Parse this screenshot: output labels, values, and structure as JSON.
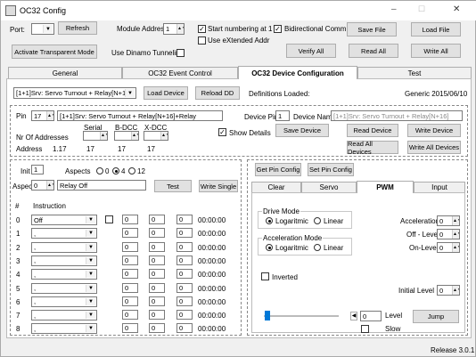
{
  "window": {
    "title": "OC32 Config",
    "min": "–",
    "max": "☐",
    "close": "✕",
    "status": "Release 3.0.1"
  },
  "top": {
    "port_label": "Port:",
    "port_value": "",
    "refresh": "Refresh",
    "module_address_label": "Module Address",
    "module_address": "1",
    "start_numbering": "Start numbering at 1",
    "use_extended": "Use eXtended Addr",
    "bidirectional": "Bidirectional Comm.",
    "save_file": "Save File",
    "load_file": "Load File",
    "activate": "Activate Transparent Mode",
    "dinamo": "Use Dinamo Tunneling",
    "verify_all": "Verify All",
    "read_all": "Read All",
    "write_all": "Write All"
  },
  "tabs": [
    {
      "label": "General"
    },
    {
      "label": "OC32 Event Control"
    },
    {
      "label": "OC32 Device Configuration"
    },
    {
      "label": "Test"
    }
  ],
  "devcfg": {
    "device_select": "[1+1]Srv: Servo Turnout + Relay[N+16]",
    "load_device": "Load Device",
    "reload_dd": "Reload DD",
    "definitions": "Definitions Loaded:",
    "generic": "Generic 2015/06/10",
    "pin_label": "Pin",
    "pin_value": "17",
    "pin_desc": "[1+1]Srv: Servo Turnout + Relay[N+16]+Relay",
    "device_pin_label": "Device Pin",
    "device_pin": "1",
    "device_name_label": "Device Name",
    "device_name": "[1+1]Srv: Servo Turnout + Relay[N+16]",
    "nr_of_addresses": "Nr Of Addresses",
    "serial": "Serial",
    "bdcc": "B-DCC",
    "xdcc": "X-DCC",
    "serial_val": "17",
    "bdcc_val": "17",
    "xdcc_val": "17",
    "address_label": "Address",
    "address_val": "1.17",
    "show_details": "Show Details",
    "save_device": "Save Device",
    "read_device": "Read Device",
    "write_device": "Write Device",
    "read_all_devices": "Read All Devices",
    "write_all_devices": "Write All Devices"
  },
  "aspects": {
    "init_label": "Init",
    "init_val": "1",
    "aspects_label": "Aspects",
    "opt0": "0",
    "opt4": "4",
    "opt12": "12",
    "aspect_label": "Aspect",
    "aspect_val": "0",
    "aspect_name": "Relay Off",
    "test": "Test",
    "write_single": "Write Single",
    "col_num": "#",
    "col_instruction": "Instruction",
    "rows": [
      {
        "n": "0",
        "instr": "Off",
        "v1": "0",
        "v2": "0",
        "v3": "0",
        "t": "00:00:00"
      },
      {
        "n": "1",
        "instr": ",",
        "v1": "0",
        "v2": "0",
        "v3": "0",
        "t": "00:00:00"
      },
      {
        "n": "2",
        "instr": ",",
        "v1": "0",
        "v2": "0",
        "v3": "0",
        "t": "00:00:00"
      },
      {
        "n": "3",
        "instr": ",",
        "v1": "0",
        "v2": "0",
        "v3": "0",
        "t": "00:00:00"
      },
      {
        "n": "4",
        "instr": ",",
        "v1": "0",
        "v2": "0",
        "v3": "0",
        "t": "00:00:00"
      },
      {
        "n": "5",
        "instr": ",",
        "v1": "0",
        "v2": "0",
        "v3": "0",
        "t": "00:00:00"
      },
      {
        "n": "6",
        "instr": ",",
        "v1": "0",
        "v2": "0",
        "v3": "0",
        "t": "00:00:00"
      },
      {
        "n": "7",
        "instr": ",",
        "v1": "0",
        "v2": "0",
        "v3": "0",
        "t": "00:00:00"
      },
      {
        "n": "8",
        "instr": ",",
        "v1": "0",
        "v2": "0",
        "v3": "0",
        "t": "00:00:00"
      }
    ]
  },
  "right": {
    "get_pin_config": "Get Pin Config",
    "set_pin_config": "Set Pin Config",
    "subtabs": [
      {
        "label": "Clear"
      },
      {
        "label": "Servo"
      },
      {
        "label": "PWM"
      },
      {
        "label": "Input"
      }
    ],
    "drive_mode": "Drive Mode",
    "logarithmic": "Logaritmic",
    "linear": "Linear",
    "accel_mode": "Acceleration Mode",
    "acceleration": "Acceleration",
    "acceleration_val": "0",
    "off_level": "Off - Level",
    "off_level_val": "0",
    "on_level": "On-Level",
    "on_level_val": "0",
    "inverted": "Inverted",
    "initial_level": "Initial Level",
    "initial_level_val": "0",
    "level": "Level",
    "level_val": "0",
    "slow": "Slow",
    "jump": "Jump"
  }
}
